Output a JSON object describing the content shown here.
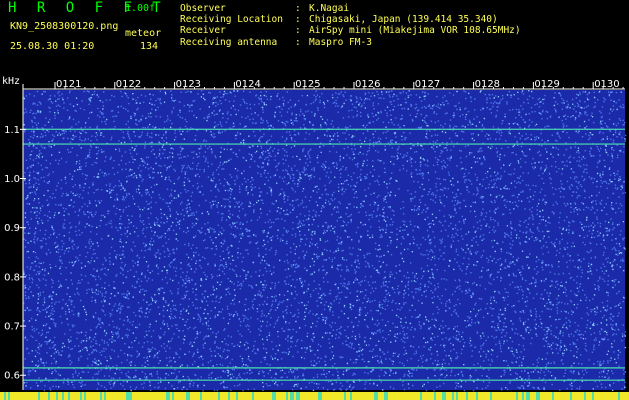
{
  "app": {
    "name": "H R O F F T",
    "version": "1.00f"
  },
  "file": {
    "name": "KN9_2508300120.png",
    "stamp": "25.08.30 01:20",
    "mode": "meteor",
    "count": "134"
  },
  "info": [
    {
      "key": "Observer",
      "value": "K.Nagai"
    },
    {
      "key": "Receiving Location",
      "value": "Chigasaki, Japan (139.414 35.340)"
    },
    {
      "key": "Receiver",
      "value": "AirSpy mini (Miakejima VOR 108.65MHz)"
    },
    {
      "key": "Receiving antenna",
      "value": "Maspro FM-3"
    }
  ],
  "chart_data": {
    "type": "heatmap",
    "ylabel": "kHz",
    "y_ticks": [
      "1.1",
      "1.0",
      "0.9",
      "0.8",
      "0.7",
      "0.6"
    ],
    "time_ticks": [
      "0121",
      "0122",
      "0123",
      "0124",
      "0125",
      "0126",
      "0127",
      "0128",
      "0129",
      "0130"
    ],
    "ylim": [
      0.57,
      1.18
    ],
    "carriers_khz": [
      1.1,
      1.07,
      0.615,
      0.59
    ],
    "colors": {
      "background": "#1a2aa8",
      "noise": "#5f8cff",
      "carrier": "#4ce0b0",
      "axis": "#ffffff",
      "tick_text": "#ffffff"
    }
  }
}
